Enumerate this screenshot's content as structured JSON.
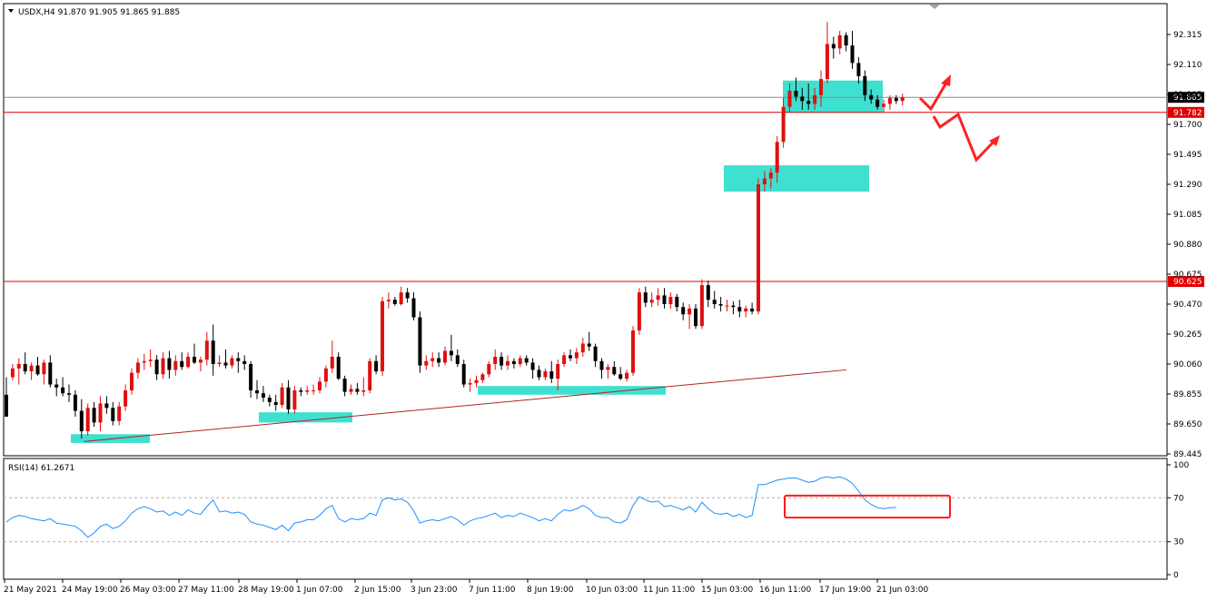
{
  "chart_data": {
    "type": "candlestick",
    "symbol_header": "USDX,H4  91.870 91.905 91.865 91.885",
    "price_axis": {
      "ticks": [
        "92.315",
        "92.110",
        "91.905",
        "91.700",
        "91.495",
        "91.290",
        "91.085",
        "90.880",
        "90.675",
        "90.470",
        "90.265",
        "90.060",
        "89.855",
        "89.650",
        "89.445"
      ],
      "range": [
        89.445,
        92.58
      ]
    },
    "current_price": "91.885",
    "levels": [
      {
        "price": 91.782,
        "label": "91.782",
        "color": "#e00000"
      },
      {
        "price": 90.625,
        "label": "90.625",
        "color": "#e00000"
      }
    ],
    "time_axis": [
      "21 May 2021",
      "24 May 19:00",
      "26 May 03:00",
      "27 May 11:00",
      "28 May 19:00",
      "1 Jun 07:00",
      "2 Jun 15:00",
      "3 Jun 23:00",
      "7 Jun 11:00",
      "8 Jun 19:00",
      "10 Jun 03:00",
      "11 Jun 11:00",
      "15 Jun 03:00",
      "16 Jun 11:00",
      "17 Jun 19:00",
      "21 Jun 03:00"
    ],
    "candles": [
      [
        89.85,
        89.97,
        89.72,
        89.7
      ],
      [
        89.97,
        90.06,
        89.95,
        90.03
      ],
      [
        90.03,
        90.1,
        89.92,
        90.06
      ],
      [
        90.06,
        90.14,
        89.99,
        90.01
      ],
      [
        90.01,
        90.07,
        89.95,
        90.05
      ],
      [
        90.05,
        90.11,
        89.98,
        89.99
      ],
      [
        89.99,
        90.09,
        89.92,
        90.07
      ],
      [
        90.07,
        90.12,
        89.9,
        89.92
      ],
      [
        89.92,
        89.96,
        89.84,
        89.9
      ],
      [
        89.9,
        89.97,
        89.84,
        89.86
      ],
      [
        89.86,
        89.92,
        89.8,
        89.85
      ],
      [
        89.85,
        89.88,
        89.7,
        89.74
      ],
      [
        89.74,
        89.82,
        89.55,
        89.6
      ],
      [
        89.6,
        89.79,
        89.57,
        89.76
      ],
      [
        89.76,
        89.8,
        89.63,
        89.66
      ],
      [
        89.66,
        89.84,
        89.6,
        89.79
      ],
      [
        89.79,
        89.84,
        89.72,
        89.76
      ],
      [
        89.76,
        89.8,
        89.64,
        89.67
      ],
      [
        89.67,
        89.8,
        89.64,
        89.77
      ],
      [
        89.77,
        89.92,
        89.74,
        89.88
      ],
      [
        89.88,
        90.03,
        89.85,
        90.0
      ],
      [
        90.0,
        90.1,
        89.96,
        90.07
      ],
      [
        90.07,
        90.13,
        90.02,
        90.08
      ],
      [
        90.08,
        90.16,
        90.04,
        90.09
      ],
      [
        90.09,
        90.12,
        89.95,
        89.99
      ],
      [
        89.99,
        90.14,
        89.96,
        90.1
      ],
      [
        90.1,
        90.15,
        89.96,
        90.02
      ],
      [
        90.02,
        90.12,
        89.98,
        90.08
      ],
      [
        90.08,
        90.14,
        90.02,
        90.04
      ],
      [
        90.04,
        90.14,
        90.03,
        90.11
      ],
      [
        90.11,
        90.2,
        90.06,
        90.07
      ],
      [
        90.07,
        90.11,
        90.01,
        90.09
      ],
      [
        90.09,
        90.28,
        90.05,
        90.22
      ],
      [
        90.22,
        90.33,
        89.98,
        90.06
      ],
      [
        90.06,
        90.12,
        90.04,
        90.07
      ],
      [
        90.07,
        90.16,
        90.03,
        90.05
      ],
      [
        90.05,
        90.12,
        90.03,
        90.1
      ],
      [
        90.1,
        90.14,
        90.0,
        90.08
      ],
      [
        90.08,
        90.12,
        90.02,
        90.06
      ],
      [
        90.06,
        90.08,
        89.83,
        89.88
      ],
      [
        89.88,
        89.95,
        89.82,
        89.86
      ],
      [
        89.86,
        89.91,
        89.8,
        89.83
      ],
      [
        89.83,
        89.85,
        89.77,
        89.8
      ],
      [
        89.8,
        89.85,
        89.74,
        89.78
      ],
      [
        89.78,
        89.93,
        89.76,
        89.9
      ],
      [
        89.9,
        89.95,
        89.72,
        89.75
      ],
      [
        89.75,
        89.91,
        89.72,
        89.88
      ],
      [
        89.88,
        89.9,
        89.84,
        89.87
      ],
      [
        89.87,
        89.91,
        89.85,
        89.88
      ],
      [
        89.88,
        89.92,
        89.85,
        89.88
      ],
      [
        89.88,
        89.97,
        89.86,
        89.94
      ],
      [
        89.94,
        90.05,
        89.9,
        90.03
      ],
      [
        90.03,
        90.22,
        90.0,
        90.11
      ],
      [
        90.11,
        90.14,
        89.95,
        89.96
      ],
      [
        89.96,
        89.98,
        89.84,
        89.87
      ],
      [
        89.87,
        89.92,
        89.85,
        89.89
      ],
      [
        89.89,
        89.93,
        89.85,
        89.87
      ],
      [
        89.87,
        89.97,
        89.84,
        89.88
      ],
      [
        89.88,
        90.1,
        89.86,
        90.08
      ],
      [
        90.08,
        90.12,
        89.99,
        90.01
      ],
      [
        90.01,
        90.52,
        89.98,
        90.49
      ],
      [
        90.49,
        90.55,
        90.44,
        90.5
      ],
      [
        90.5,
        90.52,
        90.46,
        90.47
      ],
      [
        90.47,
        90.59,
        90.46,
        90.55
      ],
      [
        90.55,
        90.58,
        90.48,
        90.51
      ],
      [
        90.51,
        90.55,
        90.36,
        90.38
      ],
      [
        90.38,
        90.42,
        90.0,
        90.05
      ],
      [
        90.05,
        90.12,
        90.02,
        90.08
      ],
      [
        90.08,
        90.14,
        90.04,
        90.1
      ],
      [
        90.1,
        90.14,
        90.04,
        90.07
      ],
      [
        90.07,
        90.18,
        90.05,
        90.15
      ],
      [
        90.15,
        90.26,
        90.08,
        90.12
      ],
      [
        90.12,
        90.16,
        90.04,
        90.06
      ],
      [
        90.06,
        90.09,
        89.9,
        89.92
      ],
      [
        89.92,
        89.96,
        89.87,
        89.93
      ],
      [
        89.93,
        89.98,
        89.9,
        89.95
      ],
      [
        89.95,
        90.0,
        89.93,
        89.99
      ],
      [
        89.99,
        90.08,
        89.97,
        90.06
      ],
      [
        90.06,
        90.16,
        90.02,
        90.11
      ],
      [
        90.11,
        90.14,
        90.02,
        90.05
      ],
      [
        90.05,
        90.12,
        90.02,
        90.08
      ],
      [
        90.08,
        90.1,
        90.03,
        90.06
      ],
      [
        90.06,
        90.12,
        90.04,
        90.1
      ],
      [
        90.1,
        90.12,
        90.05,
        90.07
      ],
      [
        90.07,
        90.1,
        89.96,
        90.02
      ],
      [
        90.02,
        90.05,
        89.95,
        89.97
      ],
      [
        89.97,
        90.03,
        89.95,
        90.01
      ],
      [
        90.01,
        90.08,
        89.93,
        89.96
      ],
      [
        89.96,
        90.09,
        89.88,
        90.06
      ],
      [
        90.06,
        90.14,
        90.04,
        90.12
      ],
      [
        90.12,
        90.16,
        90.08,
        90.1
      ],
      [
        90.1,
        90.17,
        90.06,
        90.14
      ],
      [
        90.14,
        90.24,
        90.11,
        90.2
      ],
      [
        90.2,
        90.28,
        90.15,
        90.18
      ],
      [
        90.18,
        90.2,
        90.04,
        90.08
      ],
      [
        90.08,
        90.1,
        89.96,
        90.02
      ],
      [
        90.02,
        90.06,
        89.96,
        90.04
      ],
      [
        90.04,
        90.08,
        89.98,
        89.99
      ],
      [
        89.99,
        90.04,
        89.95,
        89.96
      ],
      [
        89.96,
        90.02,
        89.94,
        90.0
      ],
      [
        90.0,
        90.32,
        89.98,
        90.29
      ],
      [
        90.29,
        90.58,
        90.26,
        90.55
      ],
      [
        90.55,
        90.59,
        90.45,
        90.48
      ],
      [
        90.48,
        90.55,
        90.45,
        90.5
      ],
      [
        90.5,
        90.58,
        90.46,
        90.53
      ],
      [
        90.53,
        90.58,
        90.44,
        90.47
      ],
      [
        90.47,
        90.55,
        90.44,
        90.52
      ],
      [
        90.52,
        90.54,
        90.42,
        90.45
      ],
      [
        90.45,
        90.48,
        90.36,
        90.4
      ],
      [
        90.4,
        90.47,
        90.3,
        90.44
      ],
      [
        90.44,
        90.47,
        90.3,
        90.32
      ],
      [
        90.32,
        90.64,
        90.3,
        90.6
      ],
      [
        90.6,
        90.63,
        90.45,
        90.5
      ],
      [
        90.5,
        90.56,
        90.44,
        90.47
      ],
      [
        90.47,
        90.52,
        90.42,
        90.46
      ],
      [
        90.46,
        90.5,
        90.42,
        90.46
      ],
      [
        90.46,
        90.49,
        90.4,
        90.45
      ],
      [
        90.45,
        90.5,
        90.38,
        90.42
      ],
      [
        90.42,
        90.46,
        90.38,
        90.44
      ],
      [
        90.44,
        90.48,
        90.4,
        90.42
      ],
      [
        90.42,
        91.33,
        90.4,
        91.29
      ],
      [
        91.29,
        91.38,
        91.24,
        91.33
      ],
      [
        91.33,
        91.4,
        91.26,
        91.37
      ],
      [
        91.37,
        91.62,
        91.3,
        91.58
      ],
      [
        91.58,
        91.88,
        91.54,
        91.82
      ],
      [
        91.82,
        91.98,
        91.78,
        91.93
      ],
      [
        91.93,
        92.02,
        91.86,
        91.89
      ],
      [
        91.89,
        91.95,
        91.8,
        91.86
      ],
      [
        91.86,
        91.98,
        91.8,
        91.84
      ],
      [
        91.84,
        91.95,
        91.8,
        91.9
      ],
      [
        91.9,
        92.07,
        91.82,
        92.01
      ],
      [
        92.01,
        92.4,
        91.98,
        92.25
      ],
      [
        92.25,
        92.3,
        92.15,
        92.22
      ],
      [
        92.22,
        92.34,
        92.18,
        92.31
      ],
      [
        92.31,
        92.33,
        92.2,
        92.24
      ],
      [
        92.24,
        92.34,
        92.08,
        92.12
      ],
      [
        92.12,
        92.16,
        91.98,
        92.03
      ],
      [
        92.03,
        92.07,
        91.86,
        91.9
      ],
      [
        91.9,
        91.94,
        91.84,
        91.87
      ],
      [
        91.87,
        91.9,
        91.8,
        91.82
      ],
      [
        91.82,
        91.87,
        91.78,
        91.84
      ],
      [
        91.84,
        91.9,
        91.8,
        91.88
      ],
      [
        91.88,
        91.9,
        91.84,
        91.86
      ],
      [
        91.86,
        91.91,
        91.83,
        91.885
      ]
    ],
    "zones": [
      {
        "from": 92.0,
        "to": 91.78
      },
      {
        "from": 91.42,
        "to": 91.24
      },
      {
        "from": 89.91,
        "to": 89.85
      },
      {
        "from": 89.73,
        "to": 89.66
      },
      {
        "from": 89.58,
        "to": 89.52
      }
    ],
    "trendline": {
      "from": 89.53,
      "to": 90.02
    },
    "rsi": {
      "label": "RSI(14) 61.2671",
      "ticks": [
        "100",
        "70",
        "30",
        "0"
      ],
      "levels": [
        70,
        30
      ],
      "values": [
        48,
        52,
        54,
        53,
        51,
        50,
        49,
        51,
        47,
        46,
        45,
        44,
        40,
        34,
        38,
        44,
        46,
        42,
        44,
        49,
        56,
        60,
        62,
        60,
        57,
        58,
        54,
        57,
        54,
        59,
        56,
        55,
        62,
        68,
        57,
        58,
        56,
        57,
        55,
        48,
        46,
        45,
        43,
        41,
        45,
        40,
        47,
        48,
        50,
        50,
        54,
        60,
        63,
        51,
        48,
        51,
        50,
        51,
        56,
        54,
        68,
        70,
        68,
        69,
        66,
        58,
        47,
        49,
        50,
        49,
        51,
        53,
        50,
        45,
        49,
        51,
        52,
        54,
        56,
        52,
        54,
        53,
        56,
        54,
        52,
        49,
        51,
        49,
        55,
        59,
        58,
        60,
        63,
        60,
        54,
        52,
        52,
        48,
        47,
        50,
        63,
        71,
        68,
        66,
        67,
        62,
        63,
        61,
        59,
        62,
        57,
        66,
        60,
        56,
        55,
        56,
        53,
        55,
        52,
        54,
        82,
        82,
        84,
        86,
        87,
        88,
        88,
        86,
        84,
        85,
        88,
        89,
        88,
        89,
        87,
        83,
        76,
        68,
        64,
        61,
        60,
        61,
        61.27
      ],
      "box": {
        "from": 72,
        "to": 52
      }
    }
  }
}
